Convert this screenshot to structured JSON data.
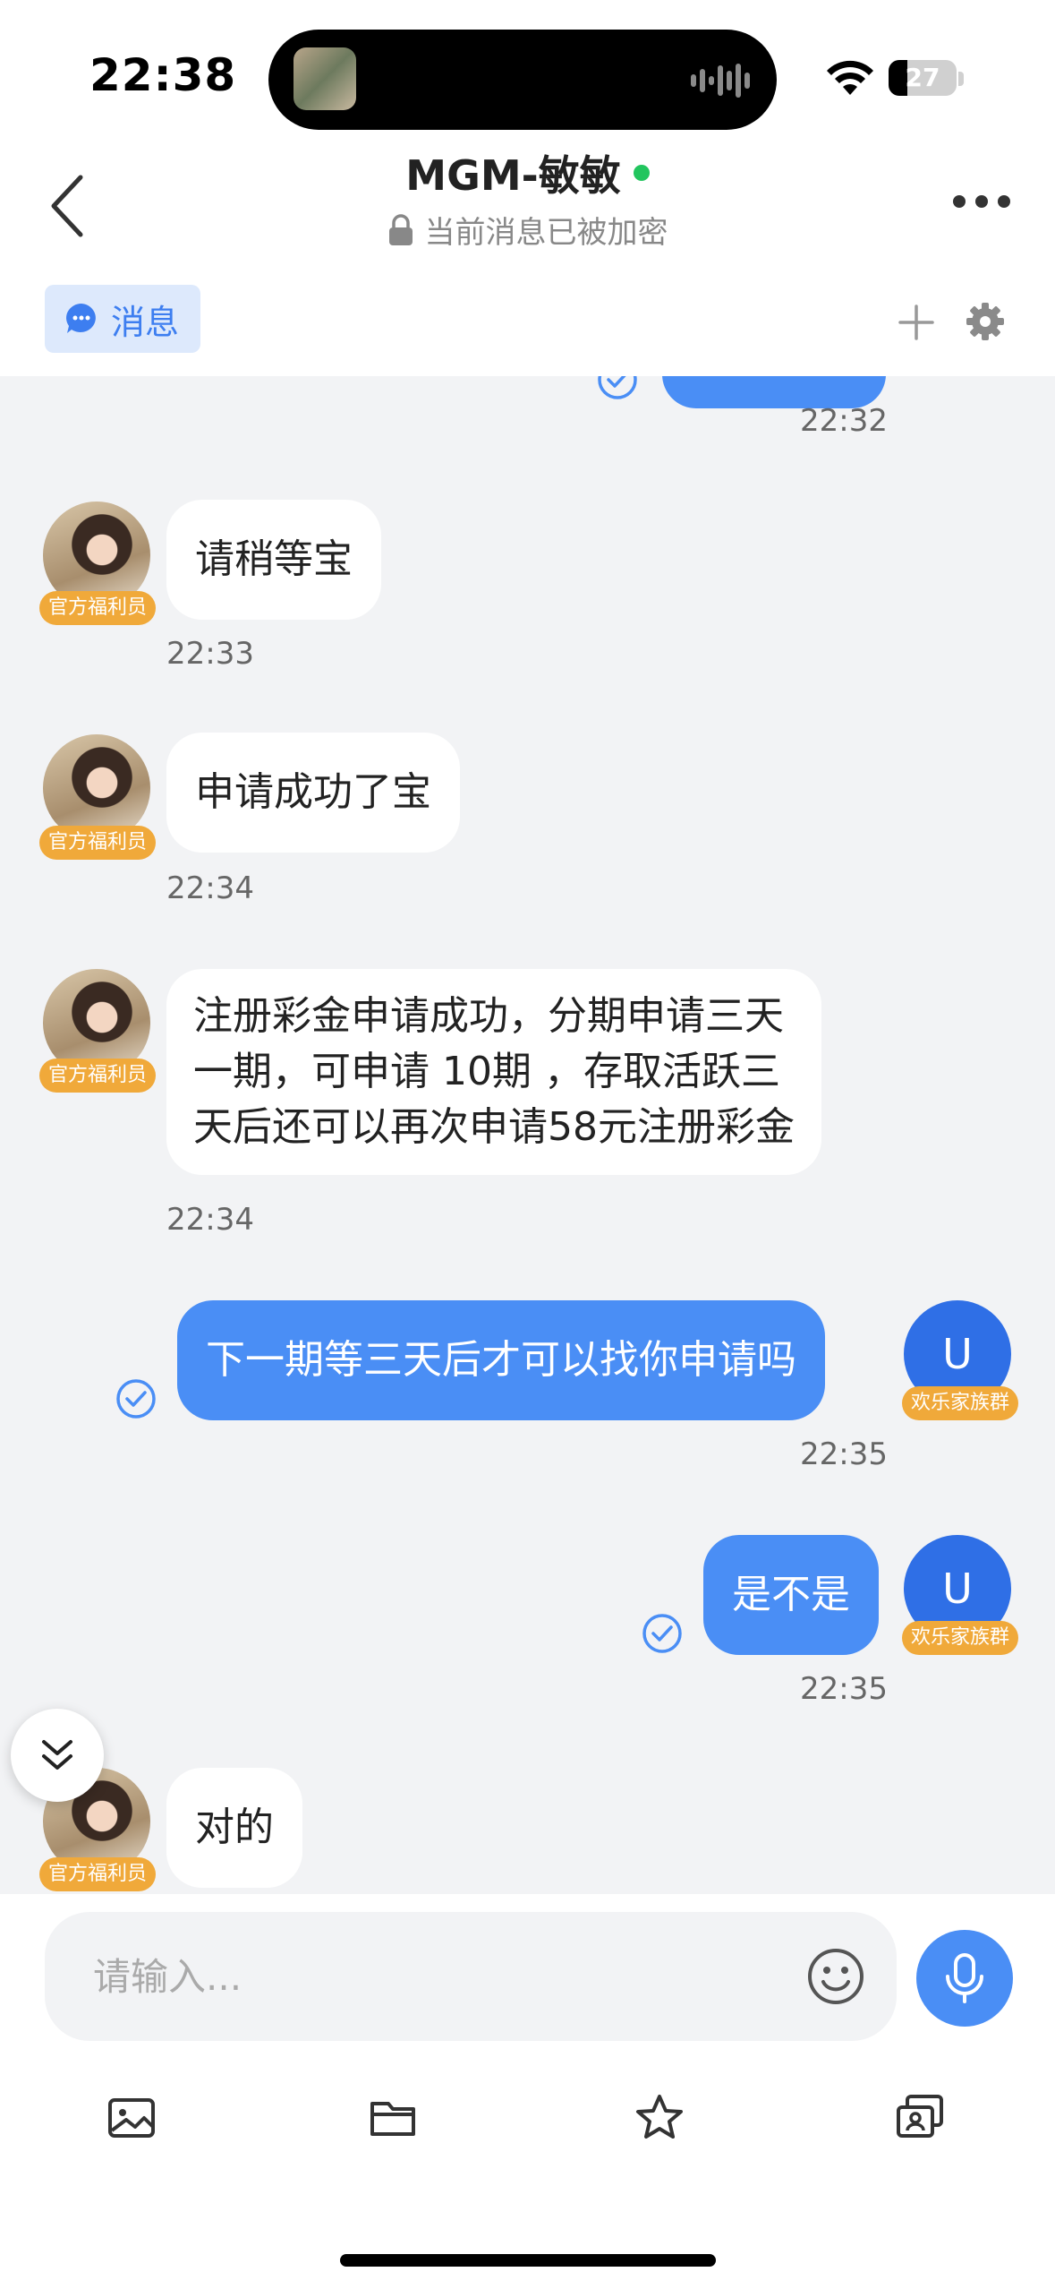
{
  "status_bar": {
    "time": "22:38",
    "battery": "27",
    "battery_level_percent": 27
  },
  "header": {
    "title": "MGM-敏敏",
    "online_color": "#22c55e",
    "encryption_note": "当前消息已被加密"
  },
  "tabs": {
    "message_tab": "消息"
  },
  "messages": [
    {
      "direction": "in",
      "text": "请稍等宝",
      "time": "22:33",
      "badge": "官方福利员"
    },
    {
      "direction": "in",
      "text": "申请成功了宝",
      "time": "22:34",
      "badge": "官方福利员"
    },
    {
      "direction": "in",
      "lines": [
        "注册彩金申请成功，分期申请三天",
        "一期，可申请 10期 ，存取活跃三",
        "天后还可以再次申请58元注册彩金"
      ],
      "time": "22:34",
      "badge": "官方福利员"
    },
    {
      "direction": "out",
      "text": "下一期等三天后才可以找你申请吗",
      "time": "22:35",
      "avatar_letter": "U",
      "badge": "欢乐家族群"
    },
    {
      "direction": "out",
      "text": "是不是",
      "time": "22:35",
      "avatar_letter": "U",
      "badge": "欢乐家族群"
    },
    {
      "direction": "in",
      "text": "对的",
      "badge": "官方福利员"
    }
  ],
  "partial_top": {
    "time": "22:32"
  },
  "composer": {
    "placeholder": "请输入..."
  },
  "colors": {
    "accent": "#4a8ef5",
    "badge": "#f0a93a",
    "avatar_u": "#2f6fe6"
  },
  "icons": [
    "back-icon",
    "lock-icon",
    "more-icon",
    "chat-bubble-icon",
    "plus-icon",
    "gear-icon",
    "check-circle-icon",
    "double-chevron-down-icon",
    "emoji-icon",
    "microphone-icon",
    "image-icon",
    "folder-icon",
    "star-icon",
    "contact-card-icon"
  ]
}
